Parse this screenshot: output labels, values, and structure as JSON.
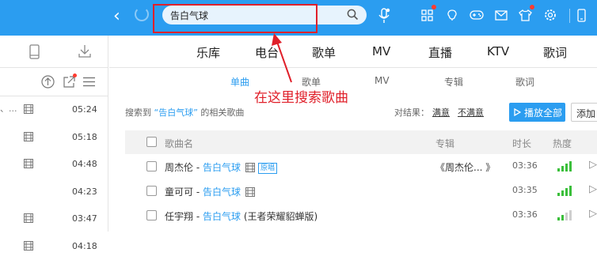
{
  "search": {
    "value": "告白气球"
  },
  "nav": {
    "tabs": [
      "乐库",
      "电台",
      "歌单",
      "MV",
      "直播",
      "KTV",
      "歌词"
    ]
  },
  "subnav": {
    "tabs": [
      "单曲",
      "歌单",
      "MV",
      "专辑",
      "歌词"
    ],
    "active": "单曲"
  },
  "annotation": {
    "text": "在这里搜索歌曲",
    "color": "#e0202a"
  },
  "left_list": {
    "times": [
      "05:24",
      "05:18",
      "04:48",
      "04:23",
      "03:47",
      "04:18"
    ],
    "first_row_prefix": "、..."
  },
  "results": {
    "prefix": "搜索到 ",
    "keyword": "“告白气球”",
    "suffix": " 的相关歌曲",
    "eval_label": "对结果：",
    "satisfied": "满意",
    "unsatisfied": "不满意",
    "play_all": "播放全部",
    "add": "添加"
  },
  "table": {
    "headers": {
      "song": "歌曲名",
      "album": "专辑",
      "duration": "时长",
      "heat": "热度"
    },
    "rows": [
      {
        "artist": "周杰伦",
        "sep": " - ",
        "title": "告白气球",
        "tag": "原唱",
        "album": "《周杰伦...  》",
        "duration": "03:36",
        "heat": 4
      },
      {
        "artist": "童可可",
        "sep": " - ",
        "title": "告白气球",
        "tag": "",
        "album": "",
        "duration": "03:35",
        "heat": 4
      },
      {
        "artist": "任宇翔",
        "sep": " - ",
        "title": "告白气球",
        "extra": " (王者荣耀貂蝉版)",
        "tag": "",
        "album": "",
        "duration": "03:36",
        "heat": 2
      }
    ]
  },
  "colors": {
    "brand": "#2b9df0",
    "accent_red": "#e0202a",
    "heat_on": "#3bbf3b"
  }
}
